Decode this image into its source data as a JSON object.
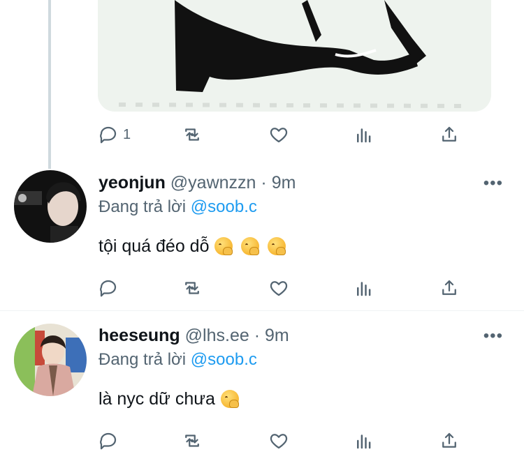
{
  "top_tweet": {
    "reply_count": "1"
  },
  "replies": [
    {
      "name": "yeonjun",
      "handle": "@yawnzzn",
      "separator": "·",
      "time": "9m",
      "replying_prefix": "Đang trả lời",
      "replying_to": "@soob.c",
      "text": "tội quá đéo dỗ",
      "emoji": [
        "face-with-hand-over-mouth",
        "face-with-hand-over-mouth",
        "face-with-hand-over-mouth"
      ]
    },
    {
      "name": "heeseung",
      "handle": "@lhs.ee",
      "separator": "·",
      "time": "9m",
      "replying_prefix": "Đang trả lời",
      "replying_to": "@soob.c",
      "text": "là nyc dữ chưa",
      "emoji": [
        "face-with-hand-over-mouth"
      ]
    }
  ],
  "more_label": "•••",
  "colors": {
    "link": "#1d9bf0",
    "secondary": "#536471",
    "primary": "#0f1419",
    "thread_line": "#cfd9de"
  }
}
